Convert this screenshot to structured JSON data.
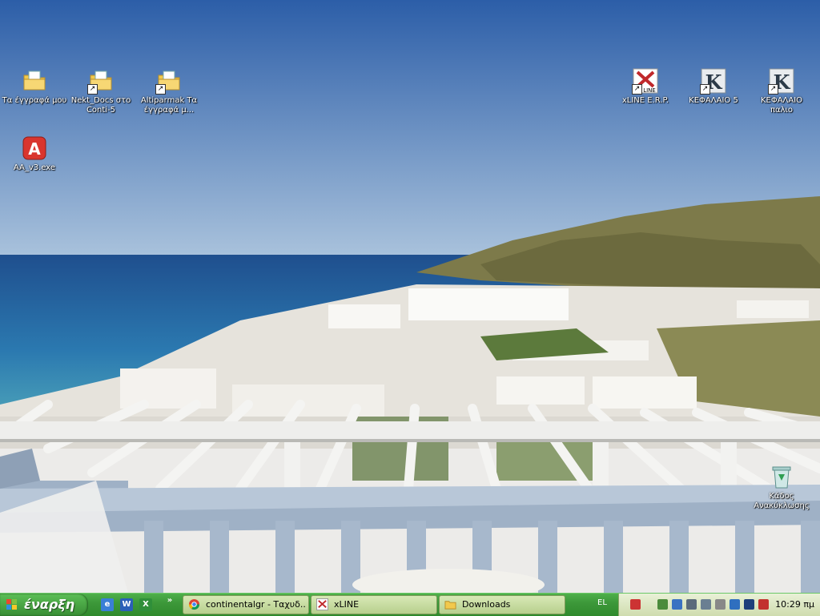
{
  "desktop": {
    "icons": [
      {
        "label": "Τα έγγραφά μου"
      },
      {
        "label": "Nekt_Docs στο Conti-5"
      },
      {
        "label": "Altiparmak Τα έγγραφά μ..."
      },
      {
        "label": "AA_v3.exe"
      },
      {
        "label": "xLINE E.R.P."
      },
      {
        "label": "ΚΕΦΑΛΑΙΟ 5"
      },
      {
        "label": "ΚΕΦΑΛΑΙΟ παλιο"
      },
      {
        "label": "Κάδος Ανακύκλωσης"
      }
    ]
  },
  "taskbar": {
    "start_label": "έναρξη",
    "quick_launch": {
      "w_letter": "W",
      "x_letter": "X",
      "overflow": "»"
    },
    "tasks": [
      {
        "label": "continentalgr - Ταχυδ..."
      },
      {
        "label": "xLINE"
      },
      {
        "label": "Downloads"
      }
    ],
    "language": "EL",
    "clock": "10:29 πμ"
  },
  "colors": {
    "taskbar": "#3d983a",
    "sky": "#3b6fb8",
    "sea": "#1a5fa0"
  }
}
